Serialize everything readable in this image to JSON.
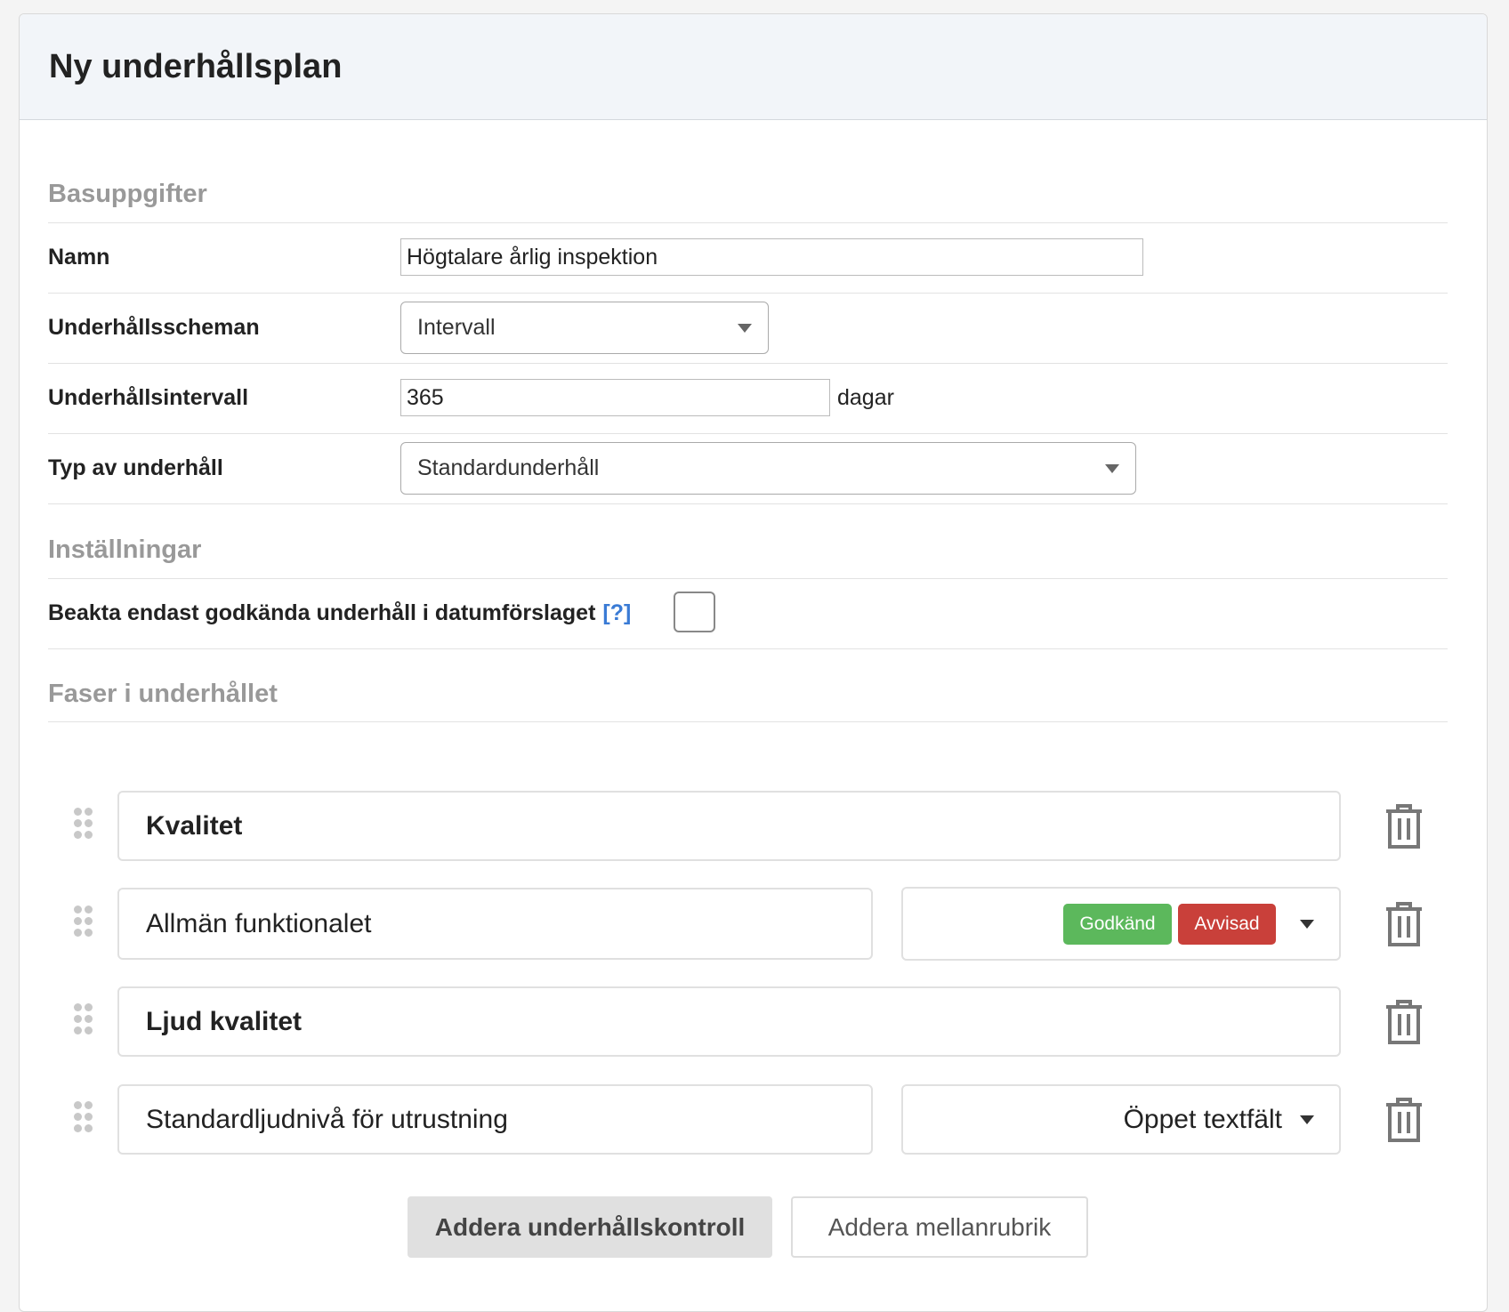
{
  "header": {
    "title": "Ny underhållsplan"
  },
  "basic": {
    "heading": "Basuppgifter",
    "name_label": "Namn",
    "name_value": "Högtalare årlig inspektion",
    "schedule_label": "Underhållsscheman",
    "schedule_value": "Intervall",
    "interval_label": "Underhållsintervall",
    "interval_value": "365",
    "interval_unit": "dagar",
    "type_label": "Typ av underhåll",
    "type_value": "Standardunderhåll"
  },
  "settings": {
    "heading": "Inställningar",
    "approved_only_label": "Beakta endast godkända underhåll i datumförslaget",
    "help_link": "[?]",
    "approved_only_checked": false
  },
  "phases": {
    "heading": "Faser i underhållet",
    "items": [
      {
        "text": "Kvalitet",
        "kind": "header"
      },
      {
        "text": "Allmän funktionalet",
        "kind": "check",
        "badges": [
          "Godkänd",
          "Avvisad"
        ]
      },
      {
        "text": "Ljud kvalitet",
        "kind": "header"
      },
      {
        "text": "Standardljudnivå för utrustning",
        "kind": "check",
        "answer_type": "Öppet textfält"
      }
    ]
  },
  "buttons": {
    "add_check": "Addera underhållskontroll",
    "add_subheading": "Addera mellanrubrik"
  },
  "colors": {
    "approved": "#5cb85c",
    "rejected": "#c9403a",
    "link": "#3a7bd5"
  }
}
